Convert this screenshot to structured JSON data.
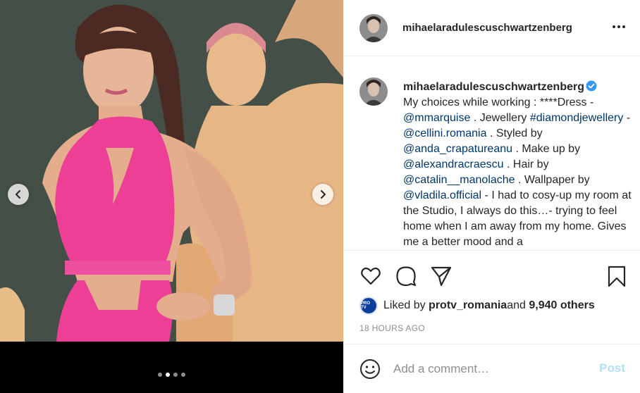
{
  "post": {
    "author": "mihaelaradulescuschwartzenberg",
    "carousel": {
      "slides": 4,
      "active_index": 1
    }
  },
  "caption": {
    "username": "mihaelaradulescuschwartzenberg",
    "verified": true,
    "segments": [
      {
        "type": "text",
        "text": "My choices while working : ****Dress - "
      },
      {
        "type": "tag",
        "text": "@mmarquise"
      },
      {
        "type": "text",
        "text": " . Jewellery "
      },
      {
        "type": "tag",
        "text": "#diamondjewellery"
      },
      {
        "type": "text",
        "text": " - "
      },
      {
        "type": "tag",
        "text": "@cellini.romania"
      },
      {
        "type": "text",
        "text": " . Styled by "
      },
      {
        "type": "tag",
        "text": "@anda_crapatureanu"
      },
      {
        "type": "text",
        "text": " . Make up by "
      },
      {
        "type": "tag",
        "text": "@alexandracraescu"
      },
      {
        "type": "text",
        "text": " . Hair by "
      },
      {
        "type": "tag",
        "text": "@catalin__manolache"
      },
      {
        "type": "text",
        "text": " . Wallpaper by "
      },
      {
        "type": "tag",
        "text": "@vladila.official"
      },
      {
        "type": "text",
        "text": " - I had to cosy-up my room at the Studio, I always do this…- trying to feel home when I am away from my home. Gives me a better mood and a"
      }
    ]
  },
  "likes": {
    "avatar_text": "PRO TV",
    "prefix": "Liked by ",
    "user": "protv_romania",
    "middle": " and ",
    "count": "9,940 others"
  },
  "timestamp": "18 HOURS AGO",
  "comment": {
    "placeholder": "Add a comment…",
    "post_label": "Post"
  },
  "colors": {
    "link": "#00376b",
    "verified": "#3897f0",
    "post_disabled": "#b2dffc",
    "muted": "#8e8e8e",
    "dress_pink": "#ec3f95"
  },
  "icons": [
    "chevron-left-icon",
    "chevron-right-icon",
    "more-icon",
    "verified-icon",
    "heart-icon",
    "comment-icon",
    "share-icon",
    "bookmark-icon",
    "emoji-icon"
  ]
}
